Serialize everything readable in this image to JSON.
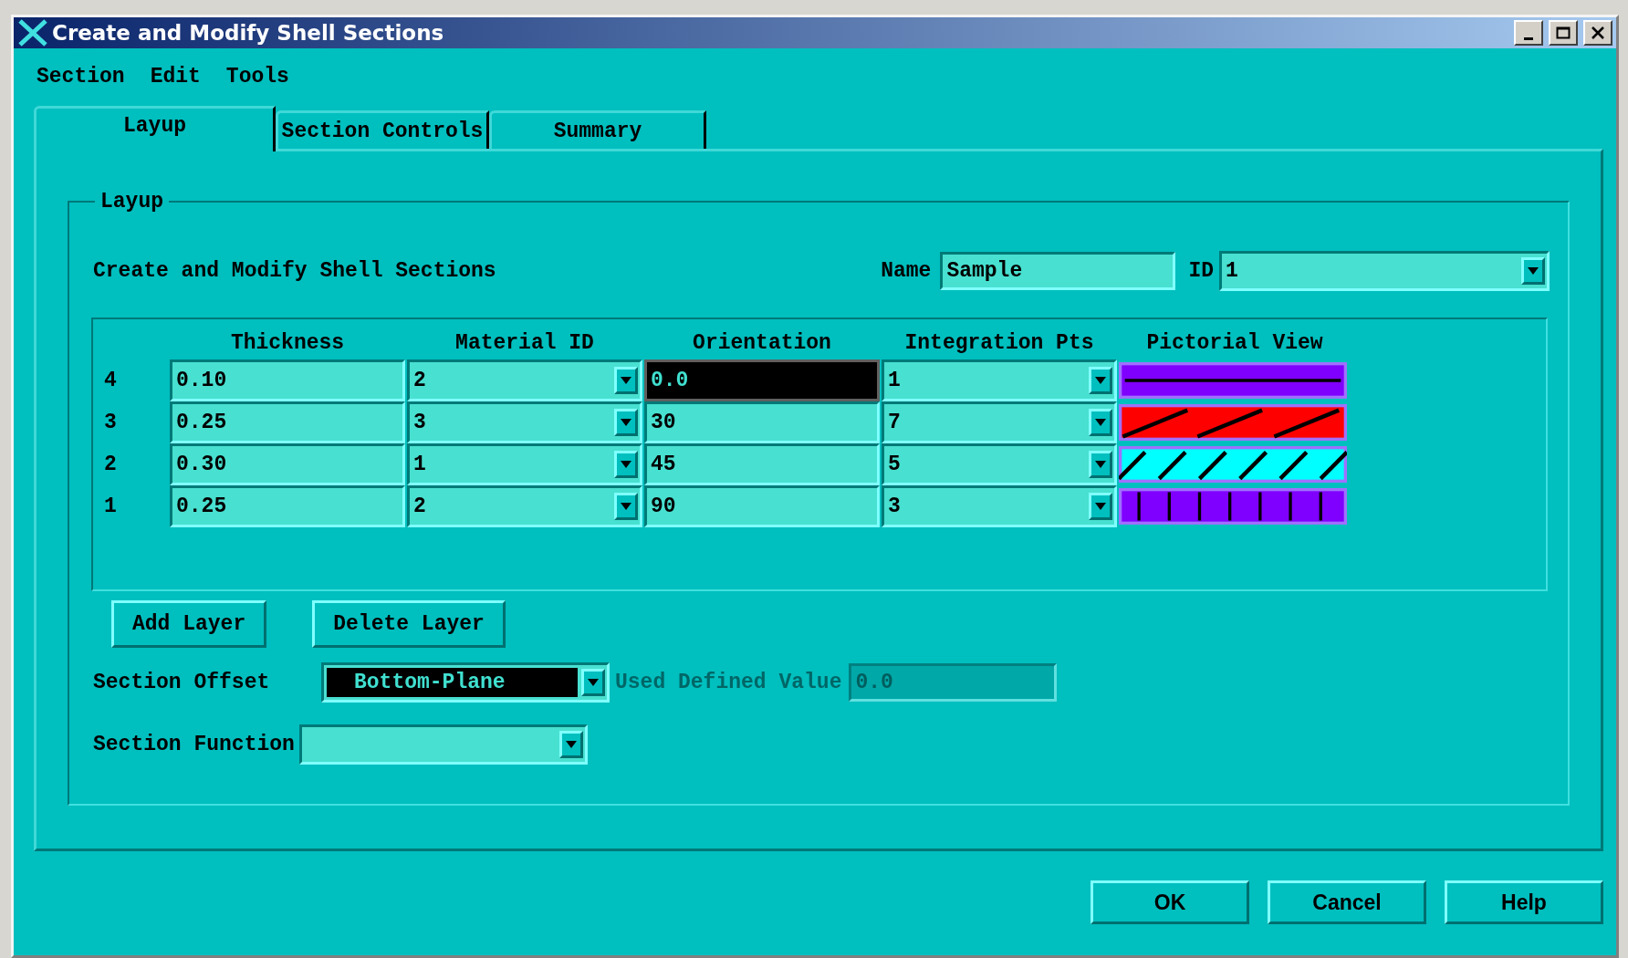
{
  "window": {
    "title": "Create and Modify Shell Sections"
  },
  "menu": [
    "Section",
    "Edit",
    "Tools"
  ],
  "tabs": [
    {
      "label": "Layup",
      "selected": true
    },
    {
      "label": "Section Controls",
      "selected": false
    },
    {
      "label": "Summary",
      "selected": false
    }
  ],
  "group": {
    "title": "Layup",
    "heading": "Create and Modify Shell Sections",
    "name_field": {
      "label": "Name",
      "value": "Sample"
    },
    "id_field": {
      "label": "ID",
      "value": "1"
    },
    "table": {
      "columns": [
        "Thickness",
        "Material ID",
        "Orientation",
        "Integration Pts",
        "Pictorial View"
      ],
      "rows": [
        {
          "layer": "4",
          "thickness": "0.10",
          "material_id": "2",
          "orientation": "0.0",
          "orientation_focused": true,
          "integration_pts": "1",
          "kind": "line",
          "color": "#8000ff"
        },
        {
          "layer": "3",
          "thickness": "0.25",
          "material_id": "3",
          "orientation": "30",
          "orientation_focused": false,
          "integration_pts": "7",
          "kind": "wide-slash",
          "color": "#ff0000"
        },
        {
          "layer": "2",
          "thickness": "0.30",
          "material_id": "1",
          "orientation": "45",
          "orientation_focused": false,
          "integration_pts": "5",
          "kind": "slash",
          "color": "#00ffff"
        },
        {
          "layer": "1",
          "thickness": "0.25",
          "material_id": "2",
          "orientation": "90",
          "orientation_focused": false,
          "integration_pts": "3",
          "kind": "ticks",
          "color": "#8000ff"
        }
      ]
    },
    "buttons": [
      "Add Layer",
      "Delete Layer"
    ],
    "section_offset": {
      "label": "Section Offset",
      "value": "Bottom-Plane",
      "highlighted": true
    },
    "user_value": {
      "label": "Used Defined Value",
      "value": "0.0",
      "disabled": true
    },
    "section_function": {
      "label": "Section Function"
    }
  },
  "dialog_buttons": [
    "OK",
    "Cancel",
    "Help"
  ]
}
